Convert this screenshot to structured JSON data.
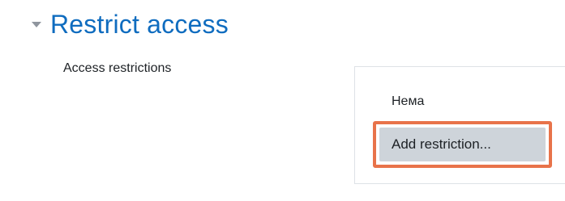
{
  "section": {
    "title": "Restrict access",
    "toggle_icon": "triangle-down-icon"
  },
  "field": {
    "label": "Access restrictions"
  },
  "restrictions": {
    "empty_text": "Нема",
    "add_button_label": "Add restriction..."
  },
  "colors": {
    "title": "#0f6cbf",
    "highlight": "#e8734a",
    "button_bg": "#ced4da"
  }
}
